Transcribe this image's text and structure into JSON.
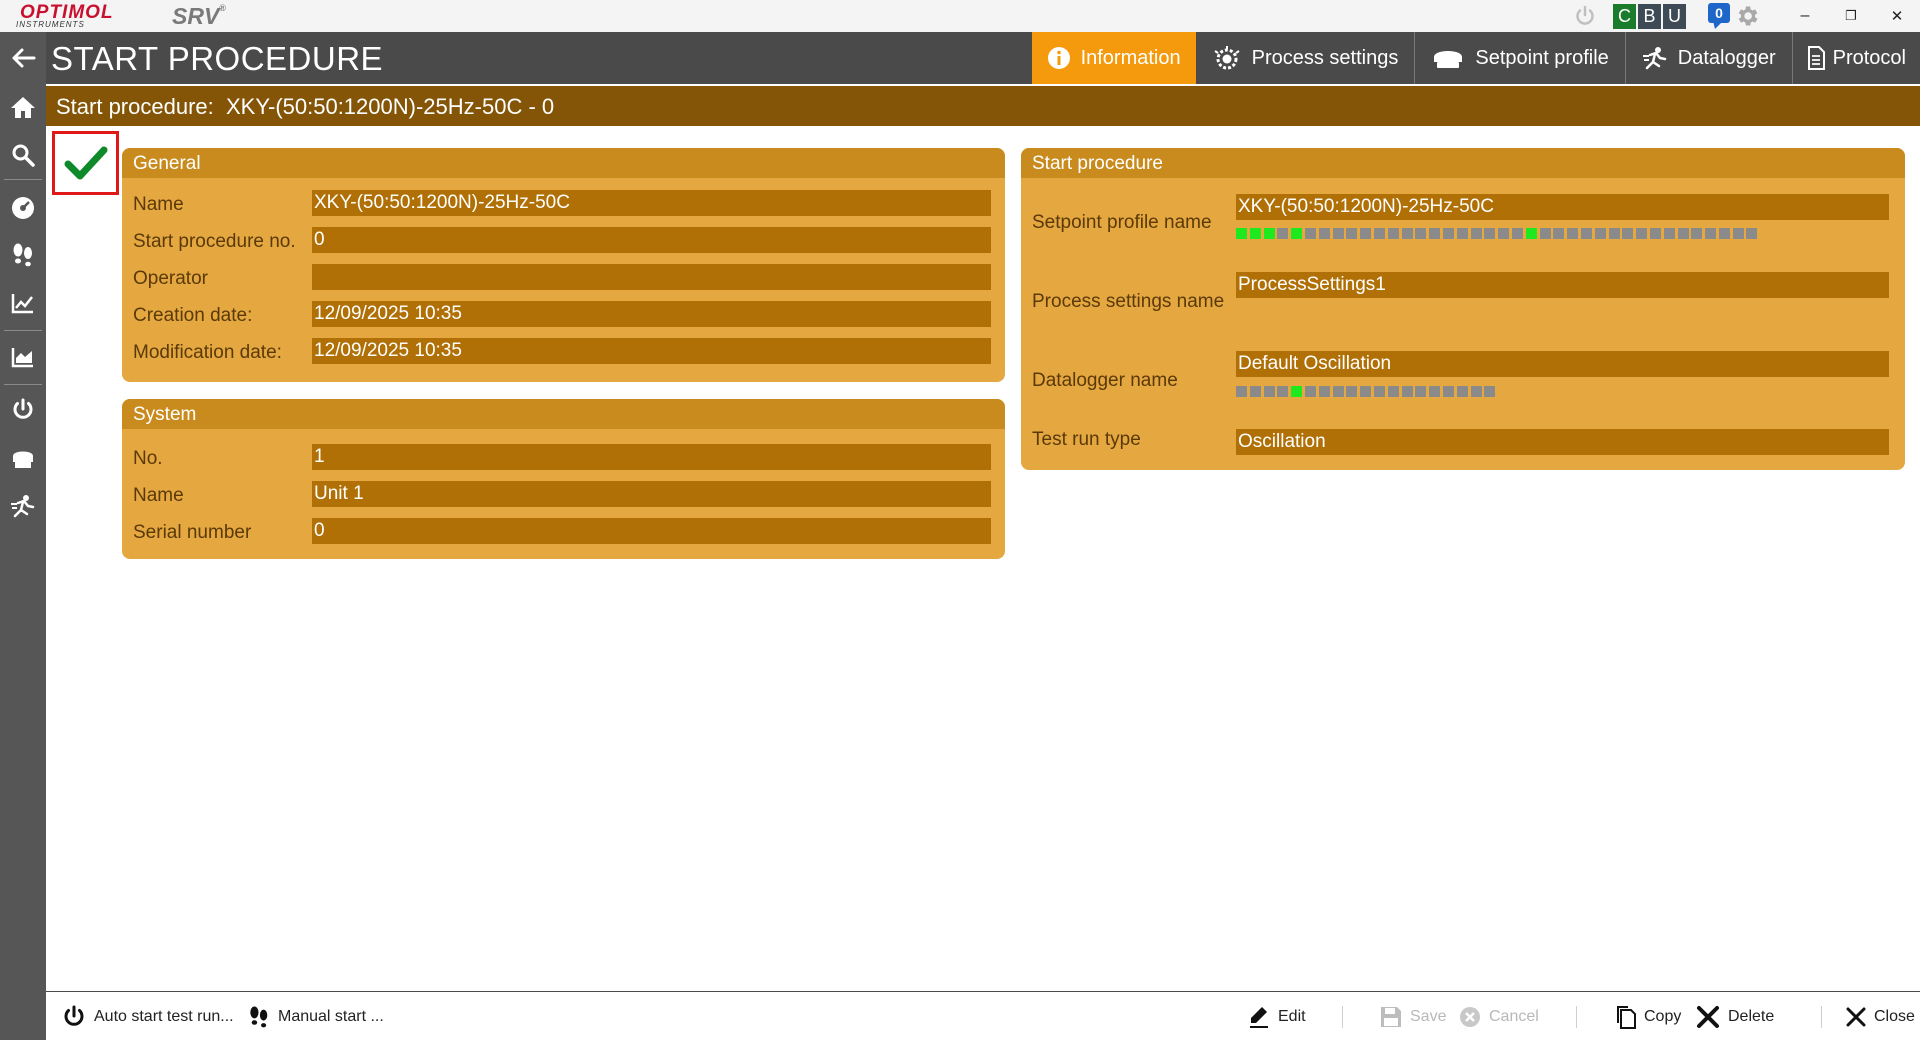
{
  "titlebar": {
    "logo_text": "OPTIMOL",
    "logo_sub": "INSTRUMENTS",
    "app_name": "SRV",
    "app_mark": "®",
    "cbu": [
      "C",
      "B",
      "U"
    ],
    "notification_count": "0",
    "window_buttons": [
      "–",
      "❐",
      "✕"
    ]
  },
  "header": {
    "title": "START PROCEDURE",
    "tabs": [
      {
        "label": "Information",
        "icon": "info-icon",
        "active": true
      },
      {
        "label": "Process settings",
        "icon": "process-settings-icon",
        "active": false
      },
      {
        "label": "Setpoint profile",
        "icon": "setpoint-profile-icon",
        "active": false
      },
      {
        "label": "Datalogger",
        "icon": "datalogger-icon",
        "active": false
      },
      {
        "label": "Protocol",
        "icon": "protocol-icon",
        "active": false
      }
    ]
  },
  "breadcrumb": {
    "label": "Start procedure:",
    "value": "XKY-(50:50:1200N)-25Hz-50C - 0"
  },
  "general": {
    "title": "General",
    "rows": [
      {
        "label": "Name",
        "value": "XKY-(50:50:1200N)-25Hz-50C"
      },
      {
        "label": "Start procedure no.",
        "value": "0"
      },
      {
        "label": "Operator",
        "value": ""
      },
      {
        "label": "Creation date:",
        "value": "12/09/2025 10:35"
      },
      {
        "label": "Modification date:",
        "value": "12/09/2025 10:35"
      }
    ]
  },
  "system": {
    "title": "System",
    "rows": [
      {
        "label": "No.",
        "value": "1"
      },
      {
        "label": "Name",
        "value": "Unit 1"
      },
      {
        "label": "Serial number",
        "value": "0"
      }
    ]
  },
  "start_procedure": {
    "title": "Start procedure",
    "setpoint_profile_label": "Setpoint profile name",
    "setpoint_profile_value": "XKY-(50:50:1200N)-25Hz-50C",
    "setpoint_segments": [
      1,
      1,
      1,
      0,
      1,
      0,
      0,
      0,
      0,
      0,
      0,
      0,
      0,
      0,
      0,
      0,
      0,
      0,
      0,
      0,
      0,
      1,
      0,
      0,
      0,
      0,
      0,
      0,
      0,
      0,
      0,
      0,
      0,
      0,
      0,
      0,
      0,
      0
    ],
    "process_settings_label": "Process settings name",
    "process_settings_value": "ProcessSettings1",
    "datalogger_label": "Datalogger name",
    "datalogger_value": "Default Oscillation",
    "datalogger_segments": [
      0,
      0,
      0,
      0,
      1,
      0,
      0,
      0,
      0,
      0,
      0,
      0,
      0,
      0,
      0,
      0,
      0,
      0,
      0
    ],
    "test_run_type_label": "Test run type",
    "test_run_type_value": "Oscillation"
  },
  "footer": {
    "auto_start": "Auto start test run...",
    "manual_start": "Manual start ...",
    "edit": "Edit",
    "save": "Save",
    "cancel": "Cancel",
    "copy": "Copy",
    "delete": "Delete",
    "close": "Close"
  },
  "colors": {
    "accent": "#f59a0c",
    "header": "#4a4a4a",
    "crumb": "#845507",
    "panel": "#e5a740",
    "panel_head": "#c98b1d",
    "field": "#b07006",
    "segment_on": "#1ee81e",
    "segment_off": "#8a8a8a"
  }
}
